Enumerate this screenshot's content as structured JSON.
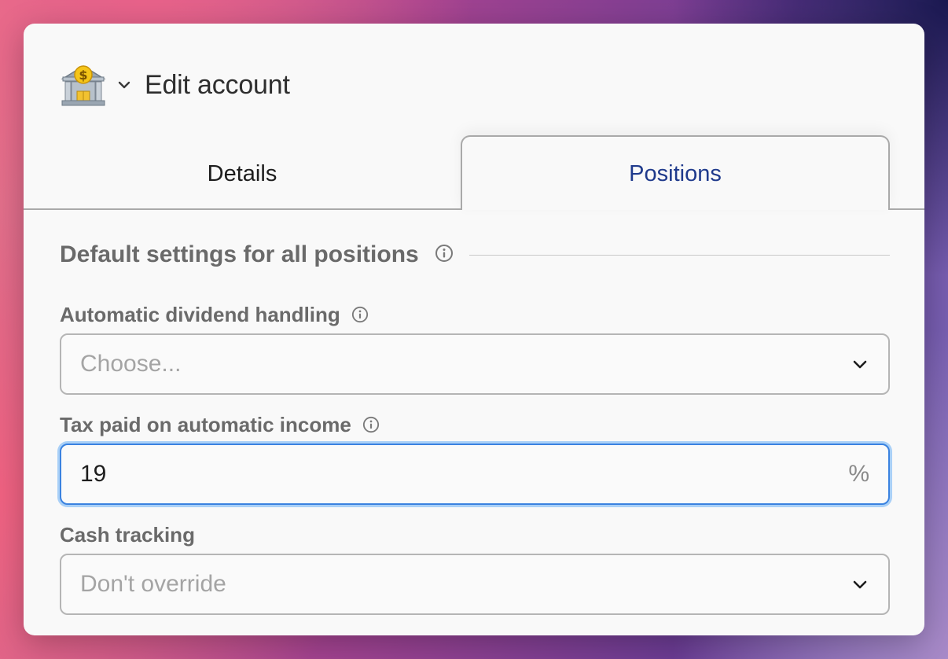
{
  "dialog": {
    "title": "Edit account",
    "icon": "bank-icon"
  },
  "tabs": [
    {
      "label": "Details",
      "active": false
    },
    {
      "label": "Positions",
      "active": true
    }
  ],
  "section": {
    "title": "Default settings for all positions"
  },
  "fields": {
    "dividend": {
      "label": "Automatic dividend handling",
      "placeholder": "Choose..."
    },
    "tax": {
      "label": "Tax paid on automatic income",
      "value": "19",
      "suffix": "%"
    },
    "cash": {
      "label": "Cash tracking",
      "value": "Don't override"
    }
  },
  "colors": {
    "accent": "#1f3a8c",
    "focus": "#3a82e0"
  }
}
